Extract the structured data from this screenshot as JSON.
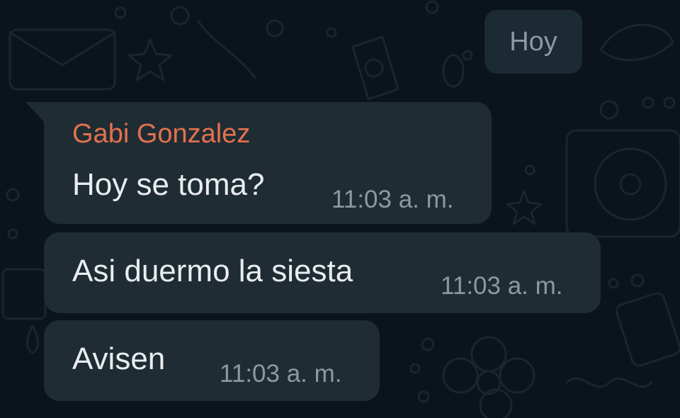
{
  "date_chip": {
    "label": "Hoy"
  },
  "messages": [
    {
      "sender": "Gabi Gonzalez",
      "text": "Hoy se toma?",
      "time": "11:03 a. m."
    },
    {
      "text": "Asi duermo la siesta",
      "time": "11:03 a. m."
    },
    {
      "text": "Avisen",
      "time": "11:03 a. m."
    }
  ],
  "colors": {
    "background": "#0b141a",
    "bubble": "#1f2c34",
    "date_chip": "#1c2a33",
    "sender_name": "#e4714e",
    "message_text": "#e9edef",
    "timestamp": "#8c999f"
  },
  "wallpaper": {
    "pattern": "doodle-pattern"
  }
}
